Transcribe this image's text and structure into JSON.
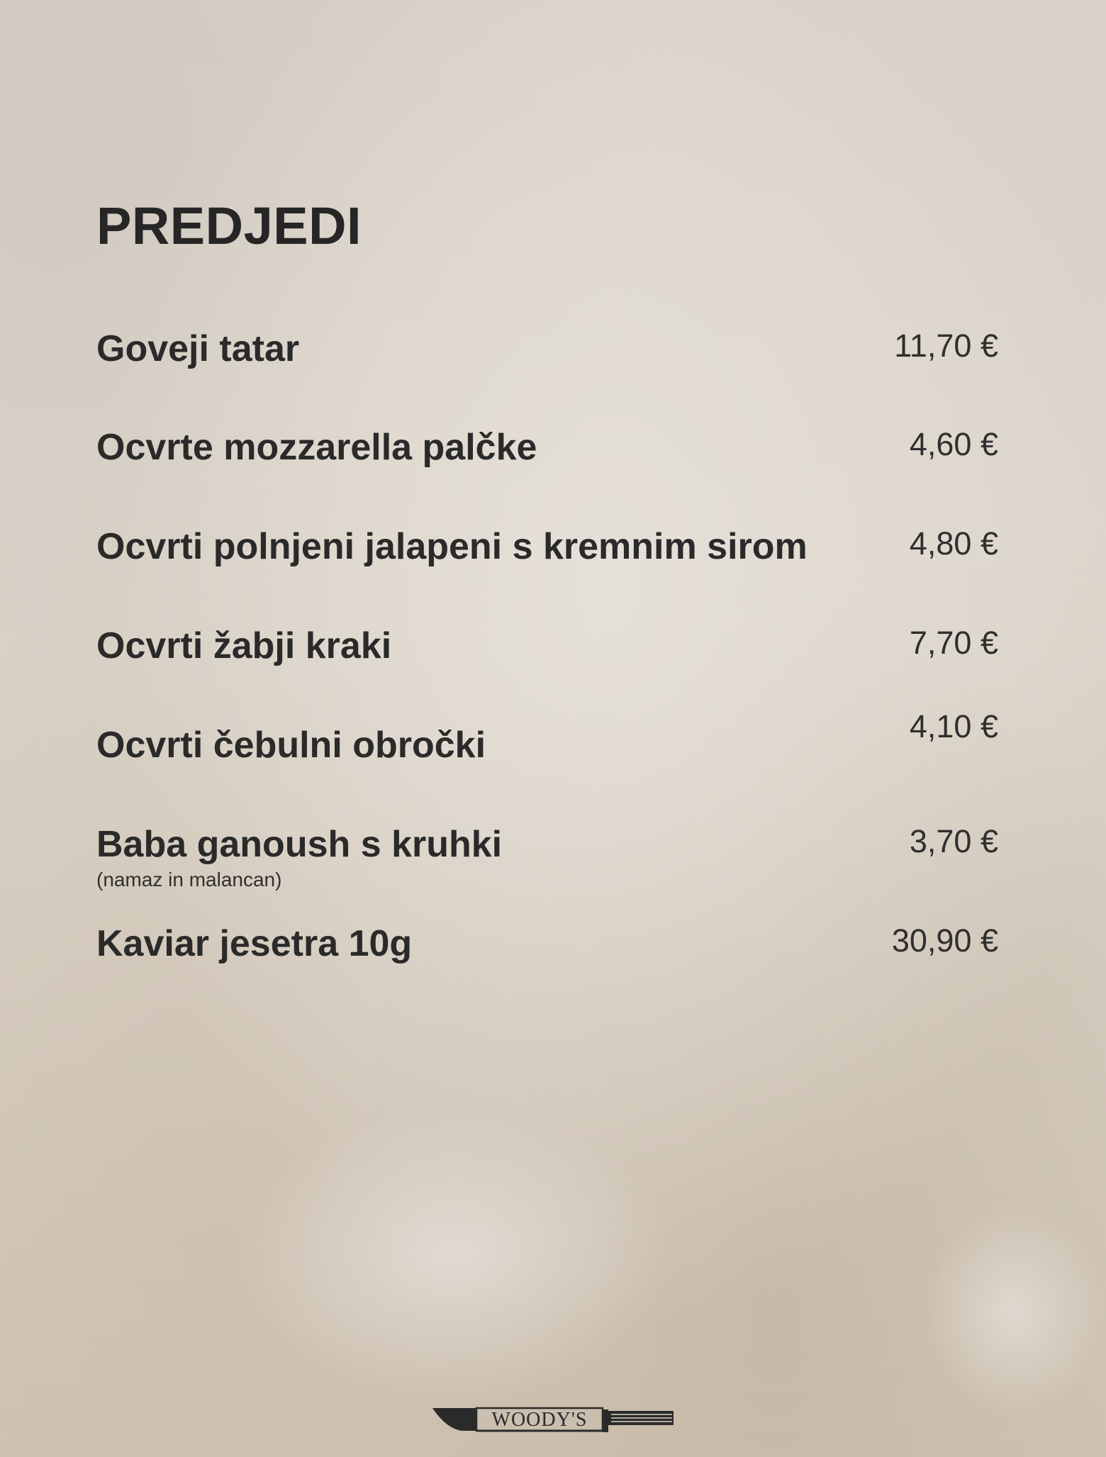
{
  "menu": {
    "heading": "PREDJEDI",
    "items": [
      {
        "name": "Goveji tatar",
        "price": "11,70 €"
      },
      {
        "name": "Ocvrte mozzarella palčke",
        "price": "4,60 €"
      },
      {
        "name": "Ocvrti polnjeni jalapeni s kremnim sirom",
        "price": "4,80 €"
      },
      {
        "name": "Ocvrti žabji kraki",
        "price": "7,70 €"
      },
      {
        "name": "Ocvrti čebulni obročki",
        "price": "4,10 €"
      },
      {
        "name": "Baba ganoush s kruhki",
        "note": "(namaz in malancan)",
        "price": "3,70 €"
      },
      {
        "name": "Kaviar jesetra 10g",
        "price": "30,90 €"
      }
    ]
  },
  "logo": {
    "text": "WOODY'S",
    "icon": "knife-icon",
    "color": "#2a2a2a"
  },
  "colors": {
    "text": "#2a2a2a",
    "paper": "#dcd5cb"
  }
}
